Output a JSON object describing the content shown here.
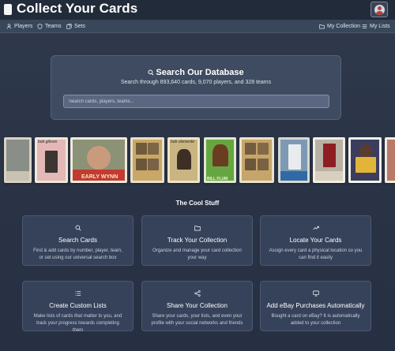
{
  "header": {
    "title": "Collect Your Cards"
  },
  "nav": {
    "players": "Players",
    "teams": "Teams",
    "sets": "Sets",
    "my_collection": "My Collection",
    "my_lists": "My Lists"
  },
  "search": {
    "title": "Search Our Database",
    "subtitle": "Search through 893,640 cards, 9,070 players, and 328 teams",
    "placeholder": "Search cards, players, teams..."
  },
  "cards": [
    {
      "top": "",
      "bottom": ""
    },
    {
      "top": "bob gibson",
      "bottom": ""
    },
    {
      "top": "",
      "bottom": "EARLY WYNN"
    },
    {
      "top": "",
      "bottom": ""
    },
    {
      "top": "bob clemente",
      "bottom": ""
    },
    {
      "top": "",
      "bottom": "BILL FLUM"
    },
    {
      "top": "",
      "bottom": ""
    },
    {
      "top": "",
      "bottom": ""
    },
    {
      "top": "",
      "bottom": ""
    },
    {
      "top": "",
      "bottom": ""
    },
    {
      "top": "",
      "bottom": ""
    }
  ],
  "features": {
    "section_title": "The Cool Stuff",
    "items": [
      {
        "icon": "search-icon",
        "title": "Search Cards",
        "desc": "Find & add cards by number, player, team, or set using our universal search box"
      },
      {
        "icon": "folder-icon",
        "title": "Track Your Collection",
        "desc": "Organize and manage your card collection your way"
      },
      {
        "icon": "trending-up-icon",
        "title": "Locate Your Cards",
        "desc": "Assign every card a physical location so you can find it easily"
      },
      {
        "icon": "list-icon",
        "title": "Create Custom Lists",
        "desc": "Make lists of cards that matter to you, and track your progress towards completing them"
      },
      {
        "icon": "share-icon",
        "title": "Share Your Collection",
        "desc": "Share your cards, your lists, and even your profile with your social networks and friends"
      },
      {
        "icon": "monitor-icon",
        "title": "Add eBay Purchases Automatically",
        "desc": "Bought a card on eBay? It is automatically added to your collection"
      }
    ]
  },
  "colors": {
    "header_bg": "#222b39",
    "nav_bg": "#39475b",
    "panel_bg": "#3f4b60",
    "feature_bg": "#36425a"
  }
}
